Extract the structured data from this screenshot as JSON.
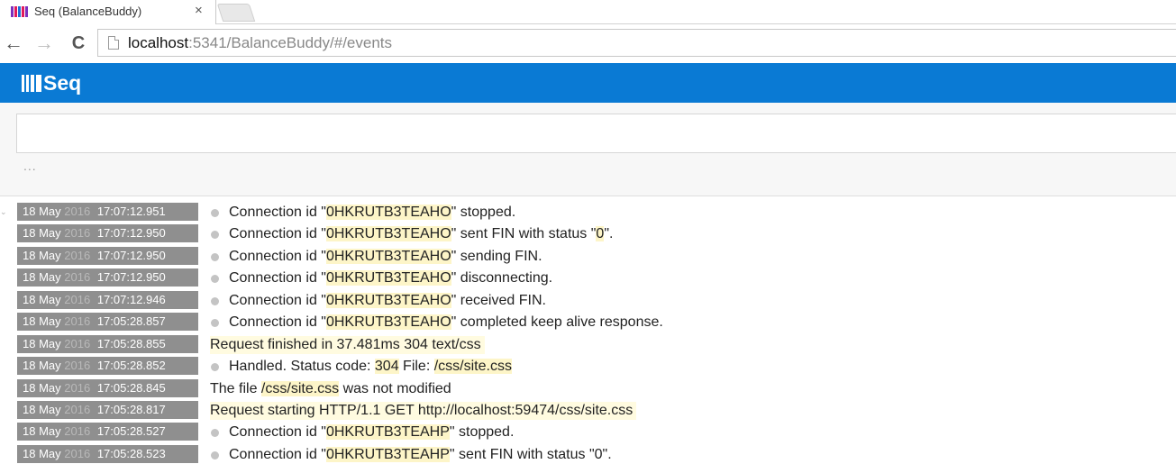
{
  "browser": {
    "tab_title": "Seq (BalanceBuddy)",
    "tab_close": "×",
    "back_icon": "←",
    "forward_icon": "→",
    "reload_icon": "C",
    "url_host": "localhost",
    "url_rest": ":5341/BalanceBuddy/#/events"
  },
  "app": {
    "logo_text": "Seq",
    "brand_color": "#0a7ad4",
    "favicon_colors": [
      "#7b2fbe",
      "#e0185c",
      "#1e6fd9",
      "#e0185c",
      "#7b2fbe"
    ]
  },
  "filter": {
    "value": "",
    "more_label": "..."
  },
  "events": [
    {
      "date": "18 May",
      "year": "2016",
      "time": "17:07:12.951",
      "dot": true,
      "highlight": false,
      "parts": [
        {
          "t": "Connection id \""
        },
        {
          "t": "0HKRUTB3TEAHO",
          "hl": true
        },
        {
          "t": "\" stopped."
        }
      ]
    },
    {
      "date": "18 May",
      "year": "2016",
      "time": "17:07:12.950",
      "dot": true,
      "highlight": false,
      "parts": [
        {
          "t": "Connection id \""
        },
        {
          "t": "0HKRUTB3TEAHO",
          "hl": true
        },
        {
          "t": "\" sent FIN with status \""
        },
        {
          "t": "0",
          "hl": true
        },
        {
          "t": "\"."
        }
      ]
    },
    {
      "date": "18 May",
      "year": "2016",
      "time": "17:07:12.950",
      "dot": true,
      "highlight": false,
      "parts": [
        {
          "t": "Connection id \""
        },
        {
          "t": "0HKRUTB3TEAHO",
          "hl": true
        },
        {
          "t": "\" sending FIN."
        }
      ]
    },
    {
      "date": "18 May",
      "year": "2016",
      "time": "17:07:12.950",
      "dot": true,
      "highlight": false,
      "parts": [
        {
          "t": "Connection id \""
        },
        {
          "t": "0HKRUTB3TEAHO",
          "hl": true
        },
        {
          "t": "\" disconnecting."
        }
      ]
    },
    {
      "date": "18 May",
      "year": "2016",
      "time": "17:07:12.946",
      "dot": true,
      "highlight": false,
      "parts": [
        {
          "t": "Connection id \""
        },
        {
          "t": "0HKRUTB3TEAHO",
          "hl": true
        },
        {
          "t": "\" received FIN."
        }
      ]
    },
    {
      "date": "18 May",
      "year": "2016",
      "time": "17:05:28.857",
      "dot": true,
      "highlight": false,
      "parts": [
        {
          "t": "Connection id \""
        },
        {
          "t": "0HKRUTB3TEAHO",
          "hl": true
        },
        {
          "t": "\" completed keep alive response."
        }
      ]
    },
    {
      "date": "18 May",
      "year": "2016",
      "time": "17:05:28.855",
      "dot": false,
      "highlight": true,
      "parts": [
        {
          "t": "Request finished in 37.481ms 304 text/css"
        }
      ]
    },
    {
      "date": "18 May",
      "year": "2016",
      "time": "17:05:28.852",
      "dot": true,
      "highlight": false,
      "parts": [
        {
          "t": "Handled. Status code: "
        },
        {
          "t": "304",
          "hl": true
        },
        {
          "t": " File: "
        },
        {
          "t": "/css/site.css",
          "hl": true
        }
      ]
    },
    {
      "date": "18 May",
      "year": "2016",
      "time": "17:05:28.845",
      "dot": false,
      "highlight": false,
      "parts": [
        {
          "t": "The file "
        },
        {
          "t": "/css/site.css",
          "hl": true
        },
        {
          "t": " was not modified"
        }
      ]
    },
    {
      "date": "18 May",
      "year": "2016",
      "time": "17:05:28.817",
      "dot": false,
      "highlight": true,
      "parts": [
        {
          "t": "Request starting HTTP/1.1 GET http://localhost:59474/css/site.css"
        }
      ]
    },
    {
      "date": "18 May",
      "year": "2016",
      "time": "17:05:28.527",
      "dot": true,
      "highlight": false,
      "parts": [
        {
          "t": "Connection id \""
        },
        {
          "t": "0HKRUTB3TEAHP",
          "hl": true
        },
        {
          "t": "\" stopped."
        }
      ]
    },
    {
      "date": "18 May",
      "year": "2016",
      "time": "17:05:28.523",
      "dot": true,
      "highlight": false,
      "parts": [
        {
          "t": "Connection id \""
        },
        {
          "t": "0HKRUTB3TEAHP",
          "hl": true
        },
        {
          "t": "\" sent FIN with status \"0\"."
        }
      ]
    }
  ]
}
